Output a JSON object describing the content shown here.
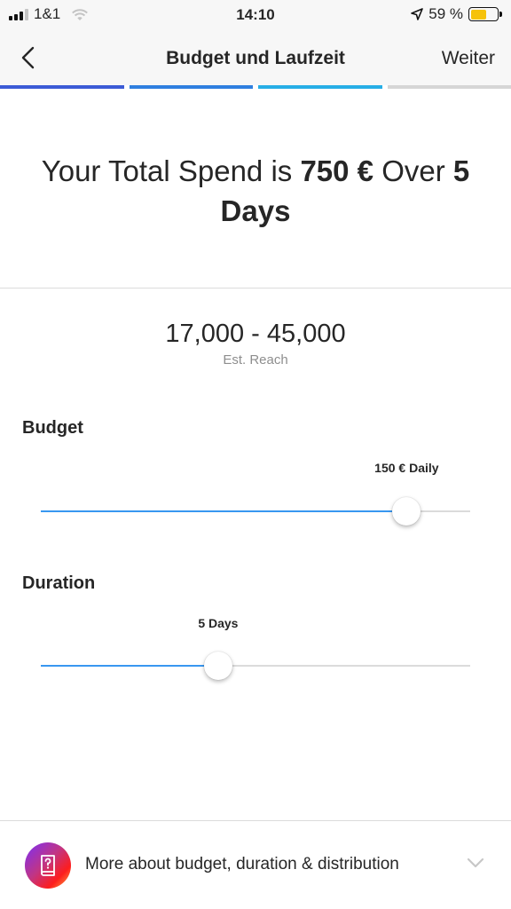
{
  "status_bar": {
    "carrier": "1&1",
    "time": "14:10",
    "battery_percent": "59 %",
    "battery_level": 0.59,
    "battery_color": "#f6c20a"
  },
  "nav": {
    "title": "Budget und Laufzeit",
    "next_label": "Weiter",
    "back_icon": "chevron-left-icon"
  },
  "progress": {
    "segments": [
      {
        "color": "#3c5bd6"
      },
      {
        "color": "#2f7fe0"
      },
      {
        "color": "#27aee6"
      },
      {
        "color": "#d6d6d6"
      }
    ]
  },
  "summary": {
    "prefix": "Your Total Spend is",
    "amount": "750 €",
    "middle": "Over",
    "days_number": "5",
    "days_word": "Days"
  },
  "reach": {
    "value": "17,000 - 45,000",
    "label": "Est. Reach"
  },
  "budget": {
    "title": "Budget",
    "value_label": "150 € Daily",
    "fraction": 0.852
  },
  "duration": {
    "title": "Duration",
    "value_label": "5 Days",
    "fraction": 0.413
  },
  "footer": {
    "text": "More about budget, duration & distribution",
    "icon": "help-book-icon",
    "chevron_icon": "chevron-down-icon"
  },
  "colors": {
    "accent": "#3897f0",
    "track": "#dbdbdb"
  }
}
